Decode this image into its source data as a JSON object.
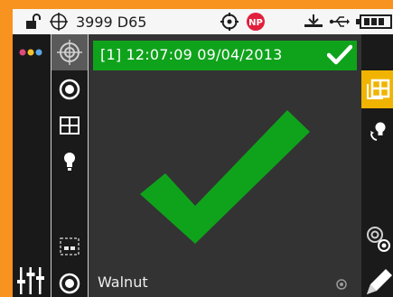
{
  "status_bar": {
    "label": "3999 D65",
    "icons": [
      "unlock-icon",
      "crosshair-icon",
      "target-icon",
      "np-badge-icon",
      "stand-icon",
      "usb-icon",
      "battery-icon"
    ],
    "np_badge": "NP"
  },
  "measurement": {
    "banner": "[1] 12:07:09 09/04/2013",
    "status": "pass",
    "sample_name": "Walnut"
  },
  "tools": {
    "left": [
      "menu-dots-icon",
      "crosshair-target-icon",
      "ring-target-icon",
      "grid-icon",
      "bulb-icon",
      "dashed-box-icon",
      "ring-target-icon"
    ],
    "right": [
      "grid-select-icon",
      "rotate-bulb-icon",
      "target-small-icon",
      "pencil-icon"
    ]
  },
  "colors": {
    "frame": "#f7931e",
    "pass_green": "#0fa31c",
    "accent_yellow": "#f0b400",
    "panel": "#333333"
  }
}
